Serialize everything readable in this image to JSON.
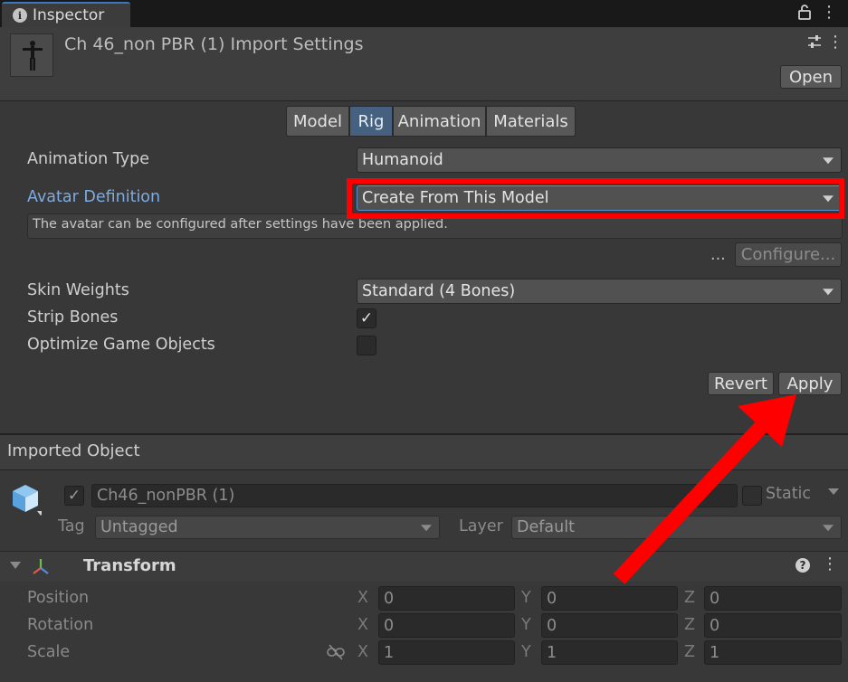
{
  "tab": {
    "label": "Inspector",
    "icon": "info-icon"
  },
  "header": {
    "title": "Ch 46_non PBR (1) Import Settings",
    "open_label": "Open"
  },
  "toolbar": {
    "tabs": [
      "Model",
      "Rig",
      "Animation",
      "Materials"
    ],
    "active": "Rig"
  },
  "rig": {
    "animation_type": {
      "label": "Animation Type",
      "value": "Humanoid"
    },
    "avatar_definition": {
      "label": "Avatar Definition",
      "value": "Create From This Model"
    },
    "help_text": "The avatar can be configured after settings have been applied.",
    "ellipsis": "...",
    "configure_label": "Configure...",
    "skin_weights": {
      "label": "Skin Weights",
      "value": "Standard (4 Bones)"
    },
    "strip_bones": {
      "label": "Strip Bones",
      "checked": true
    },
    "optimize": {
      "label": "Optimize Game Objects",
      "checked": false
    },
    "revert_label": "Revert",
    "apply_label": "Apply"
  },
  "imported": {
    "section_label": "Imported Object",
    "name": "Ch46_nonPBR (1)",
    "active": true,
    "static_label": "Static",
    "tag_label": "Tag",
    "tag_value": "Untagged",
    "layer_label": "Layer",
    "layer_value": "Default"
  },
  "transform": {
    "title": "Transform",
    "rows": [
      {
        "label": "Position",
        "x": "0",
        "y": "0",
        "z": "0"
      },
      {
        "label": "Rotation",
        "x": "0",
        "y": "0",
        "z": "0"
      },
      {
        "label": "Scale",
        "x": "1",
        "y": "1",
        "z": "1"
      }
    ],
    "axis_x": "X",
    "axis_y": "Y",
    "axis_z": "Z"
  },
  "colors": {
    "accent": "#3a79bb",
    "highlight": "#ff0000",
    "link": "#7dabe3",
    "active_tab": "#466080"
  }
}
